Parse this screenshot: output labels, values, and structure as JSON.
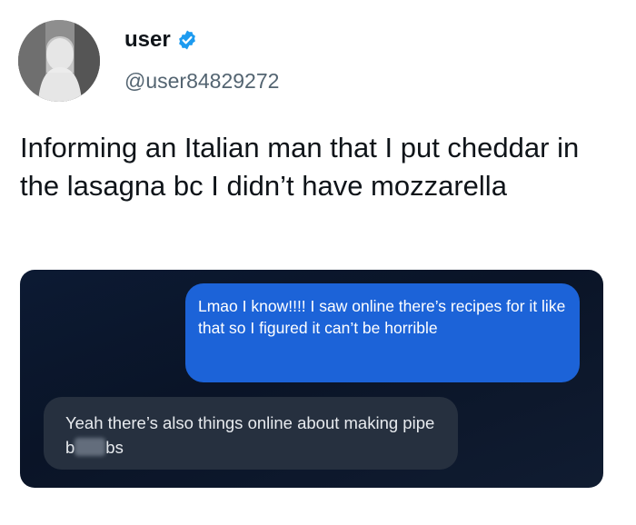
{
  "tweet": {
    "display_name": "user",
    "handle": "@user84829272",
    "text": "Informing an Italian man that I put cheddar in the lasagna bc I didn’t have mozzarella"
  },
  "screenshot": {
    "sent_message": "Lmao I know!!!! I saw online there’s recipes for it like that so I figured it can’t be horrible",
    "received_message_before": "Yeah there’s also things online about making pipe b",
    "received_message_after": "bs"
  },
  "colors": {
    "verified_badge": "#1d9bf0",
    "sent_bubble": "#1c63d8",
    "received_bubble": "#26303f",
    "screenshot_background": "#0c1a33"
  },
  "icons": {
    "verified": "verified-badge-icon"
  }
}
